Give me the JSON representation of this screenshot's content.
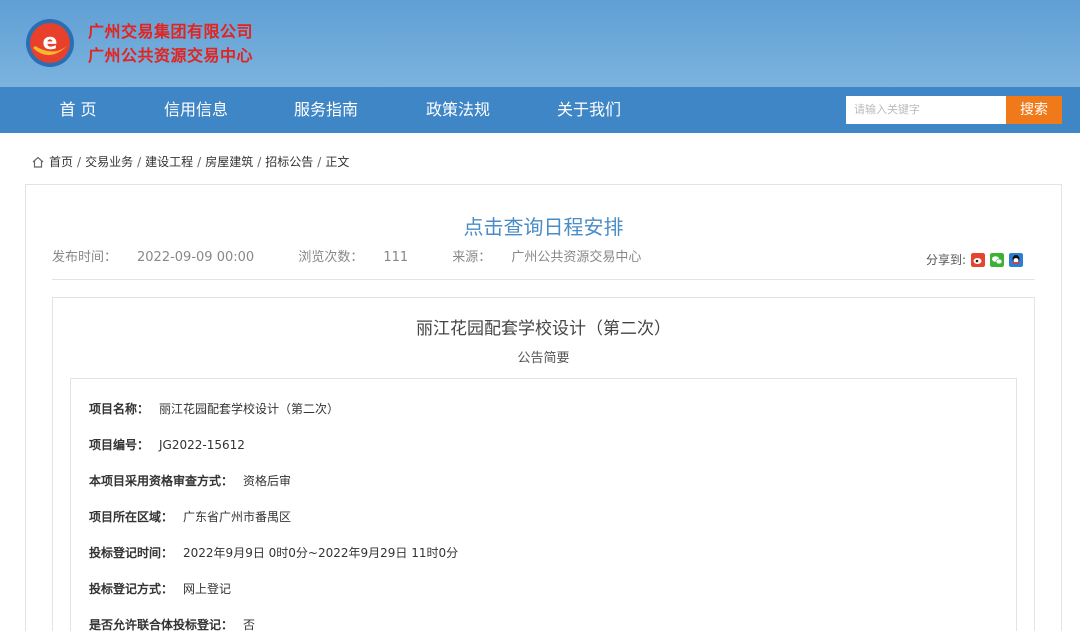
{
  "header": {
    "org_line1": "广州交易集团有限公司",
    "org_line2": "广州公共资源交易中心",
    "logo_letter": "e"
  },
  "nav": {
    "items": [
      "首 页",
      "信用信息",
      "服务指南",
      "政策法规",
      "关于我们"
    ],
    "search_placeholder": "请输入关键字",
    "search_button": "搜索"
  },
  "breadcrumb": [
    "首页",
    "交易业务",
    "建设工程",
    "房屋建筑",
    "招标公告",
    "正文"
  ],
  "article": {
    "title": "点击查询日程安排",
    "publish_label": "发布时间：",
    "publish_time": "2022-09-09 00:00",
    "views_label": "浏览次数：",
    "views": "111",
    "source_label": "来源：",
    "source": "广州公共资源交易中心",
    "share_label": "分享到:"
  },
  "doc": {
    "title": "丽江花园配套学校设计（第二次）",
    "subtitle": "公告简要",
    "fields": [
      {
        "key": "项目名称：",
        "value": "丽江花园配套学校设计（第二次）"
      },
      {
        "key": "项目编号：",
        "value": "JG2022-15612"
      },
      {
        "key": "本项目采用资格审查方式：",
        "value": "资格后审"
      },
      {
        "key": "项目所在区域：",
        "value": "广东省广州市番禺区"
      },
      {
        "key": "投标登记时间：",
        "value": "2022年9月9日 0时0分~2022年9月29日 11时0分"
      },
      {
        "key": "投标登记方式：",
        "value": "网上登记"
      },
      {
        "key": "是否允许联合体投标登记：",
        "value": "否"
      }
    ]
  },
  "colors": {
    "header_bg": "#6aa8d9",
    "nav_bg": "#3f86c7",
    "org_text": "#e3231f",
    "title_blue": "#4a8cc6",
    "search_btn": "#f07a1a"
  },
  "icons": [
    "home-icon",
    "weibo-icon",
    "wechat-icon",
    "qq-icon"
  ]
}
